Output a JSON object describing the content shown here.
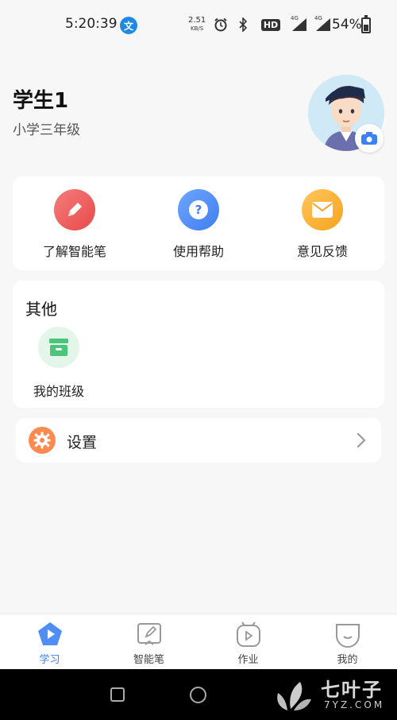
{
  "status_bar": {
    "time": "5:20:39",
    "net_speed": "2.51",
    "net_unit": "KB/S",
    "hd_label": "HD",
    "signal1": "4G",
    "signal2": "4G",
    "battery": "54%"
  },
  "profile": {
    "name": "学生1",
    "grade": "小学三年级"
  },
  "quick_actions": [
    {
      "label": "了解智能笔",
      "icon": "pencil-icon",
      "color": "#f0575a"
    },
    {
      "label": "使用帮助",
      "icon": "help-icon",
      "color": "#4f8ef7"
    },
    {
      "label": "意见反馈",
      "icon": "mail-icon",
      "color": "#fbb03b"
    }
  ],
  "other": {
    "title": "其他",
    "items": [
      {
        "label": "我的班级",
        "icon": "class-icon",
        "color": "#4cc47a"
      }
    ]
  },
  "settings": {
    "label": "设置",
    "icon": "gear-icon"
  },
  "tabs": [
    {
      "label": "学习",
      "icon": "play-pentagon-icon",
      "active": true
    },
    {
      "label": "智能笔",
      "icon": "pen-note-icon",
      "active": false
    },
    {
      "label": "作业",
      "icon": "homework-icon",
      "active": false
    },
    {
      "label": "我的",
      "icon": "profile-icon",
      "active": false
    }
  ],
  "watermark": {
    "text": "七叶子",
    "sub": "7YZ.COM"
  },
  "colors": {
    "active_tab": "#3b82f6",
    "settings_icon": "#ff8a50"
  }
}
